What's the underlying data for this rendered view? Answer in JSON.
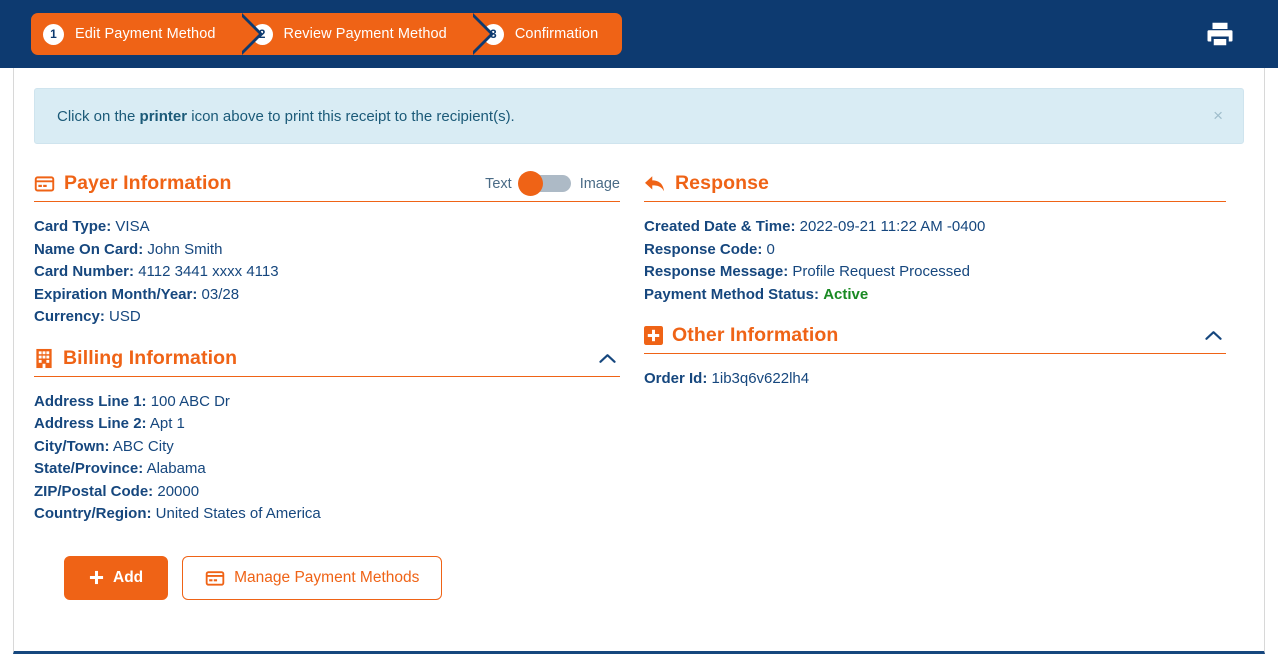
{
  "colors": {
    "navy": "#0d3a70",
    "orange": "#ef6316",
    "banner_bg": "#d9ecf4",
    "status_green": "#1a8a23",
    "text_navy": "#16477e"
  },
  "header": {
    "steps": [
      {
        "number": "1",
        "label": "Edit Payment Method"
      },
      {
        "number": "2",
        "label": "Review Payment Method"
      },
      {
        "number": "3",
        "label": "Confirmation"
      }
    ],
    "printer_icon": "printer-icon"
  },
  "banner": {
    "text_before": "Click on the ",
    "text_bold": "printer",
    "text_after": " icon above to print this receipt to the recipient(s).",
    "close_label": "×"
  },
  "payer": {
    "title": "Payer Information",
    "icon": "credit-card-icon",
    "toggle": {
      "left_label": "Text",
      "right_label": "Image",
      "selected": "Text"
    },
    "fields": [
      {
        "label": "Card Type:",
        "value": "VISA"
      },
      {
        "label": "Name On Card:",
        "value": "John Smith"
      },
      {
        "label": "Card Number:",
        "value": "4112 3441 xxxx 4113"
      },
      {
        "label": "Expiration Month/Year:",
        "value": "03/28"
      },
      {
        "label": "Currency:",
        "value": "USD"
      }
    ]
  },
  "billing": {
    "title": "Billing Information",
    "icon": "building-icon",
    "collapse_icon": "chevron-up-icon",
    "fields": [
      {
        "label": "Address Line 1:",
        "value": "100 ABC Dr"
      },
      {
        "label": "Address Line 2:",
        "value": "Apt 1"
      },
      {
        "label": "City/Town:",
        "value": "ABC City"
      },
      {
        "label": "State/Province:",
        "value": "Alabama"
      },
      {
        "label": "ZIP/Postal Code:",
        "value": "20000"
      },
      {
        "label": "Country/Region:",
        "value": "United States of America"
      }
    ]
  },
  "response": {
    "title": "Response",
    "icon": "reply-arrow-icon",
    "fields": [
      {
        "label": "Created Date & Time:",
        "value": "2022-09-21 11:22 AM -0400"
      },
      {
        "label": "Response Code:",
        "value": "0"
      },
      {
        "label": "Response Message:",
        "value": "Profile Request Processed"
      },
      {
        "label": "Payment Method Status:",
        "value": "Active",
        "highlight": "green"
      }
    ]
  },
  "other": {
    "title": "Other Information",
    "icon": "plus-square-icon",
    "collapse_icon": "chevron-up-icon",
    "fields": [
      {
        "label": "Order Id:",
        "value": "1ib3q6v622lh4"
      }
    ]
  },
  "buttons": {
    "add": {
      "label": "Add",
      "icon": "plus-icon"
    },
    "manage": {
      "label": "Manage Payment Methods",
      "icon": "credit-card-icon"
    }
  }
}
